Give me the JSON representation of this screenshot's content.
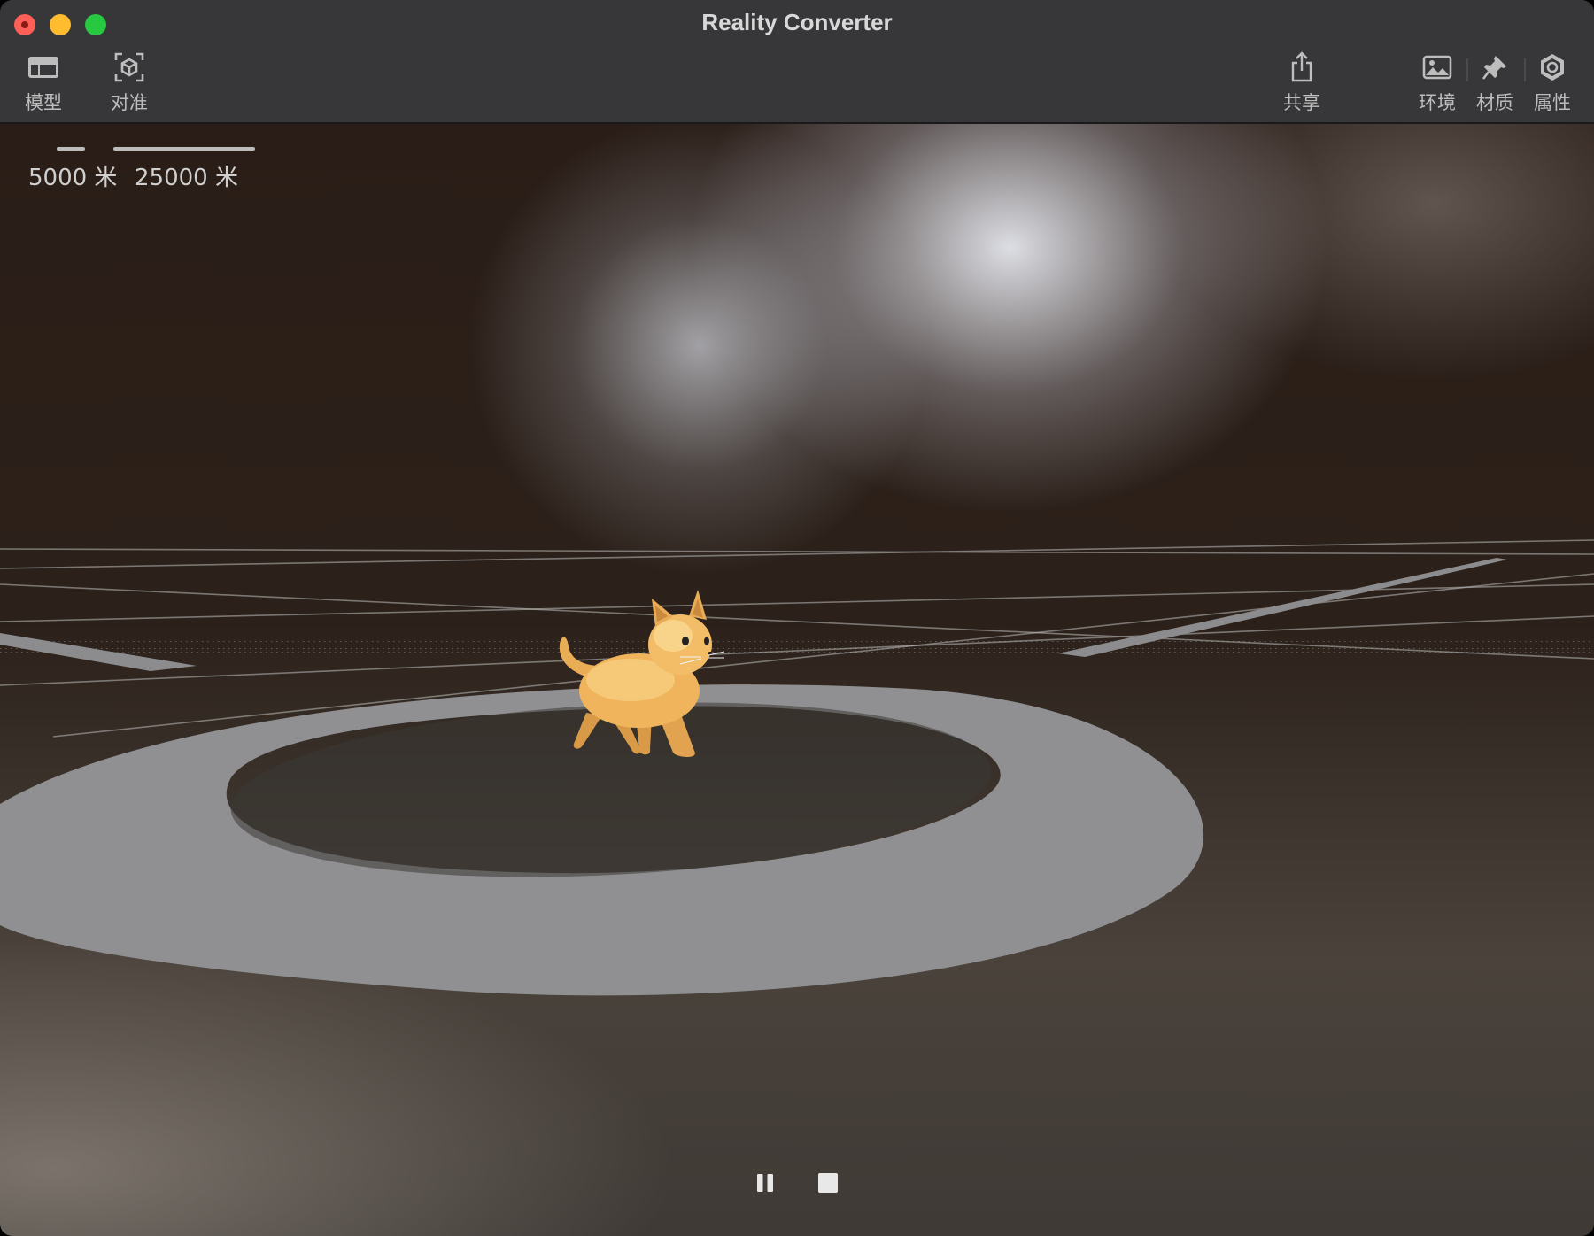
{
  "window": {
    "title": "Reality Converter"
  },
  "toolbar": {
    "left": [
      {
        "label": "模型",
        "icon": "sidebar-icon"
      },
      {
        "label": "对准",
        "icon": "ar-cube-icon"
      }
    ],
    "center": [
      {
        "label": "共享",
        "icon": "share-icon"
      }
    ],
    "right": [
      {
        "label": "环境",
        "icon": "photo-icon"
      },
      {
        "label": "材质",
        "icon": "pin-icon"
      },
      {
        "label": "属性",
        "icon": "gear-icon"
      }
    ]
  },
  "viewport": {
    "scale_small": "5000 米",
    "scale_large": "25000 米",
    "object": "cat-model"
  },
  "playback": {
    "pause_icon": "pause-icon",
    "stop_icon": "stop-icon"
  },
  "colors": {
    "titlebar": "#373739",
    "close": "#fe5f57",
    "minimize": "#febc2e",
    "maximize": "#28c840",
    "ring": "#8f8f92",
    "cat_body": "#f2b65c"
  }
}
